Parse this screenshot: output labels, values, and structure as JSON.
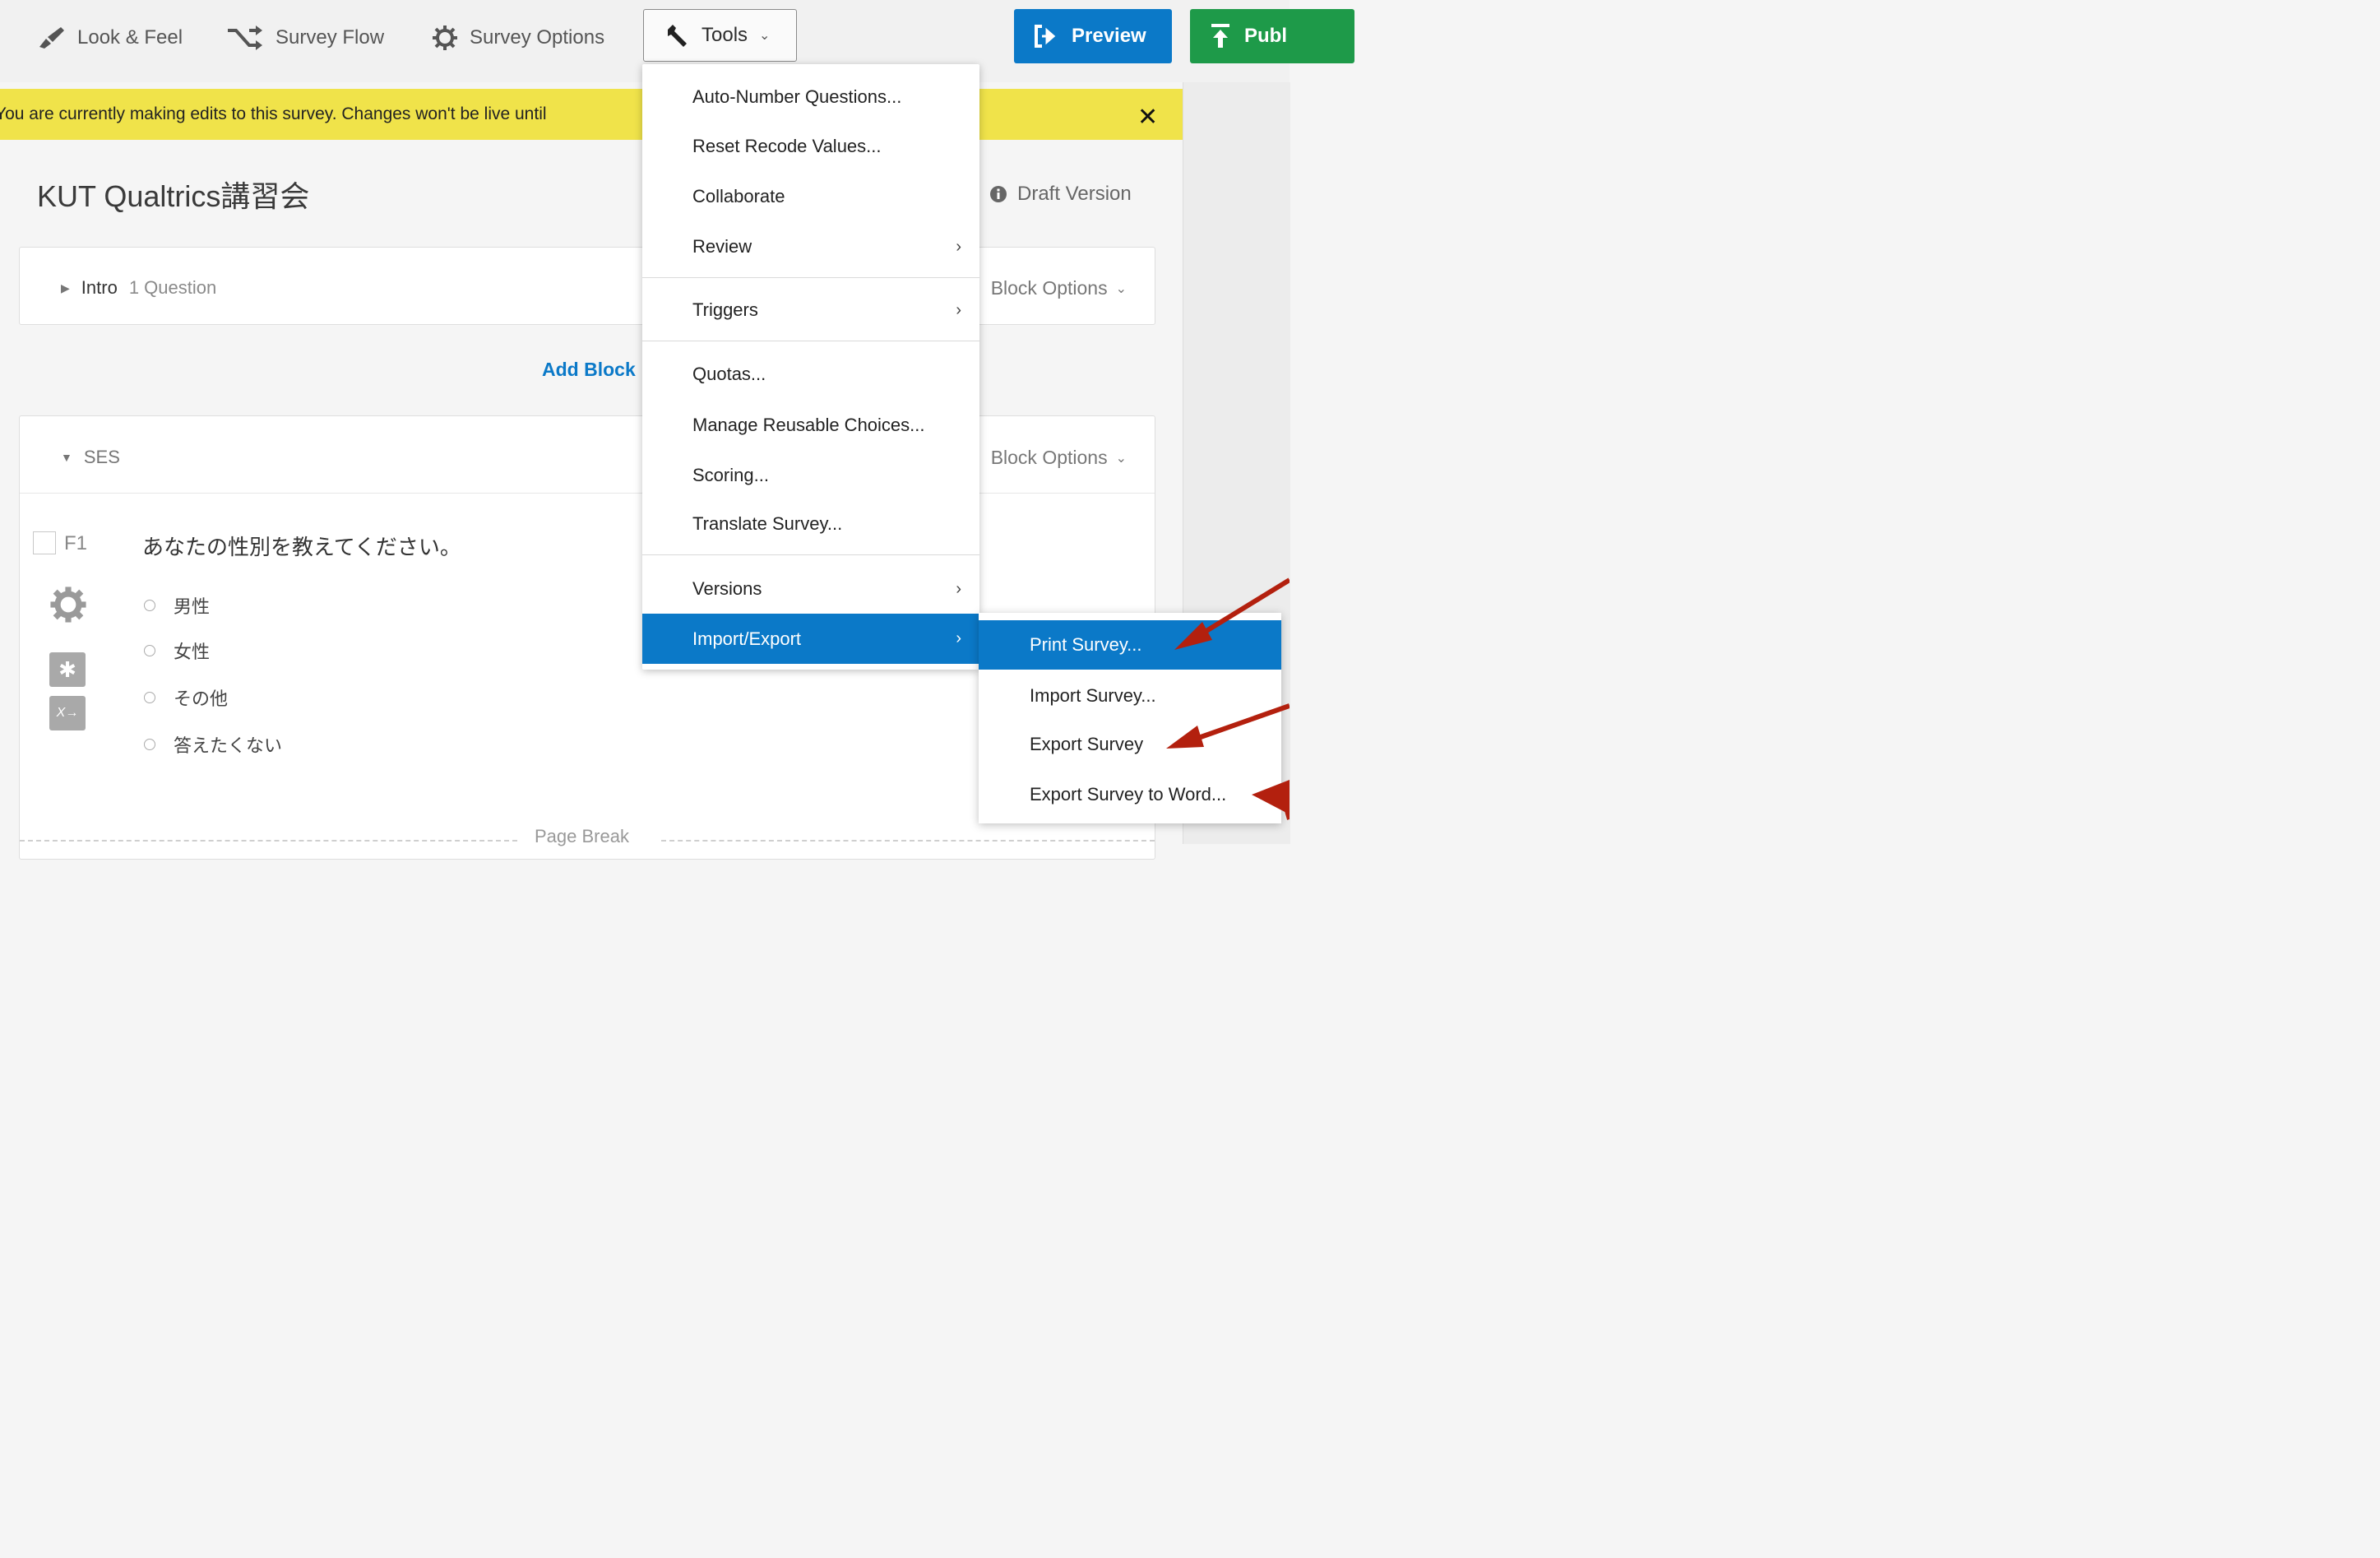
{
  "toolbar": {
    "look_feel": "Look & Feel",
    "survey_flow": "Survey Flow",
    "survey_options": "Survey Options",
    "tools": "Tools",
    "preview": "Preview",
    "publish": "Publ"
  },
  "banner": {
    "text": "You are currently making edits to this survey. Changes won't be live until"
  },
  "survey": {
    "title": "KUT Qualtrics講習会",
    "draft": "Draft Version",
    "add_block": "Add Block",
    "page_break": "Page Break",
    "blocks": [
      {
        "name": "Intro",
        "count": "1 Question",
        "options": "Block Options"
      },
      {
        "name": "SES",
        "options": "Block Options"
      }
    ],
    "question": {
      "id": "F1",
      "text": "あなたの性別を教えてください。",
      "choices": [
        "男性",
        "女性",
        "その他",
        "答えたくない"
      ]
    }
  },
  "tools_menu": {
    "items": [
      "Auto-Number Questions...",
      "Reset Recode Values...",
      "Collaborate",
      "Review",
      "Triggers",
      "Quotas...",
      "Manage Reusable Choices...",
      "Scoring...",
      "Translate Survey...",
      "Versions",
      "Import/Export"
    ],
    "submenu": [
      "Print Survey...",
      "Import Survey...",
      "Export Survey",
      "Export Survey to Word..."
    ]
  },
  "colors": {
    "accent": "#0b79c8",
    "publish": "#1e9a49",
    "banner": "#f0e34a",
    "annotation_arrow": "#b3200e"
  }
}
